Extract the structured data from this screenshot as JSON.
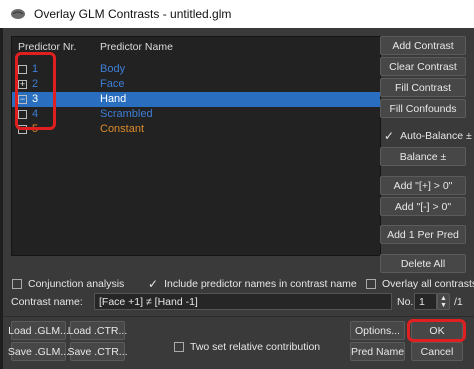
{
  "window": {
    "title": "Overlay GLM Contrasts - untitled.glm"
  },
  "list": {
    "header_nr": "Predictor Nr.",
    "header_name": "Predictor Name",
    "rows": [
      {
        "nr": "1",
        "name": "Body",
        "color": "#3e7fd6",
        "mark": ""
      },
      {
        "nr": "2",
        "name": "Face",
        "color": "#3e7fd6",
        "mark": "+"
      },
      {
        "nr": "3",
        "name": "Hand",
        "color": "#ffffff",
        "mark": "−"
      },
      {
        "nr": "4",
        "name": "Scrambled",
        "color": "#3e7fd6",
        "mark": ""
      },
      {
        "nr": "5",
        "name": "Constant",
        "color": "#d98b2b",
        "mark": ""
      }
    ],
    "selected_row": 3
  },
  "side_buttons": {
    "add_contrast": "Add Contrast",
    "clear_contrast": "Clear Contrast",
    "fill_contrast": "Fill Contrast",
    "fill_confounds": "Fill Confounds",
    "auto_balance": "Auto-Balance ±",
    "balance": "Balance ±",
    "add_plus": "Add \"[+] > 0\"",
    "add_minus": "Add \"[-]  > 0\"",
    "add_one_per_pred": "Add 1 Per Pred",
    "delete_all": "Delete All"
  },
  "options": {
    "conjunction": "Conjunction analysis",
    "include_names": "Include predictor names in contrast name",
    "overlay_all": "Overlay all contrasts"
  },
  "contrast": {
    "label": "Contrast name:",
    "value": "[Face +1] ≠ [Hand -1]",
    "no_label": "No.",
    "no_value": "1",
    "total": "/1"
  },
  "bottom": {
    "load_glm": "Load .GLM...",
    "load_ctr": "Load .CTR...",
    "save_glm": "Save .GLM...",
    "save_ctr": "Save .CTR...",
    "two_set": "Two set relative contribution",
    "options": "Options...",
    "ok": "OK",
    "pred_name": "Pred  Name",
    "cancel": "Cancel"
  },
  "colors": {
    "selection": "#2a6fbf",
    "highlight": "#e02020"
  }
}
